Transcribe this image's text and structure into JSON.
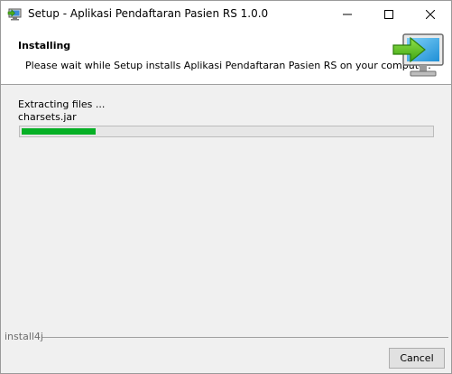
{
  "window": {
    "title": "Setup - Aplikasi Pendaftaran Pasien RS 1.0.0",
    "controls": {
      "minimize": "minimize-icon",
      "maximize": "maximize-icon",
      "close": "close-icon"
    }
  },
  "header": {
    "title": "Installing",
    "subtitle": "Please wait while Setup installs Aplikasi Pendaftaran Pasien RS on your computer.",
    "icon": "monitor-install-arrow-icon"
  },
  "main": {
    "status_text": "Extracting files ...",
    "current_file": "charsets.jar",
    "progress": 0.18,
    "progress_color": "#06b025"
  },
  "footer": {
    "brand": "install4j",
    "cancel_label": "Cancel"
  }
}
